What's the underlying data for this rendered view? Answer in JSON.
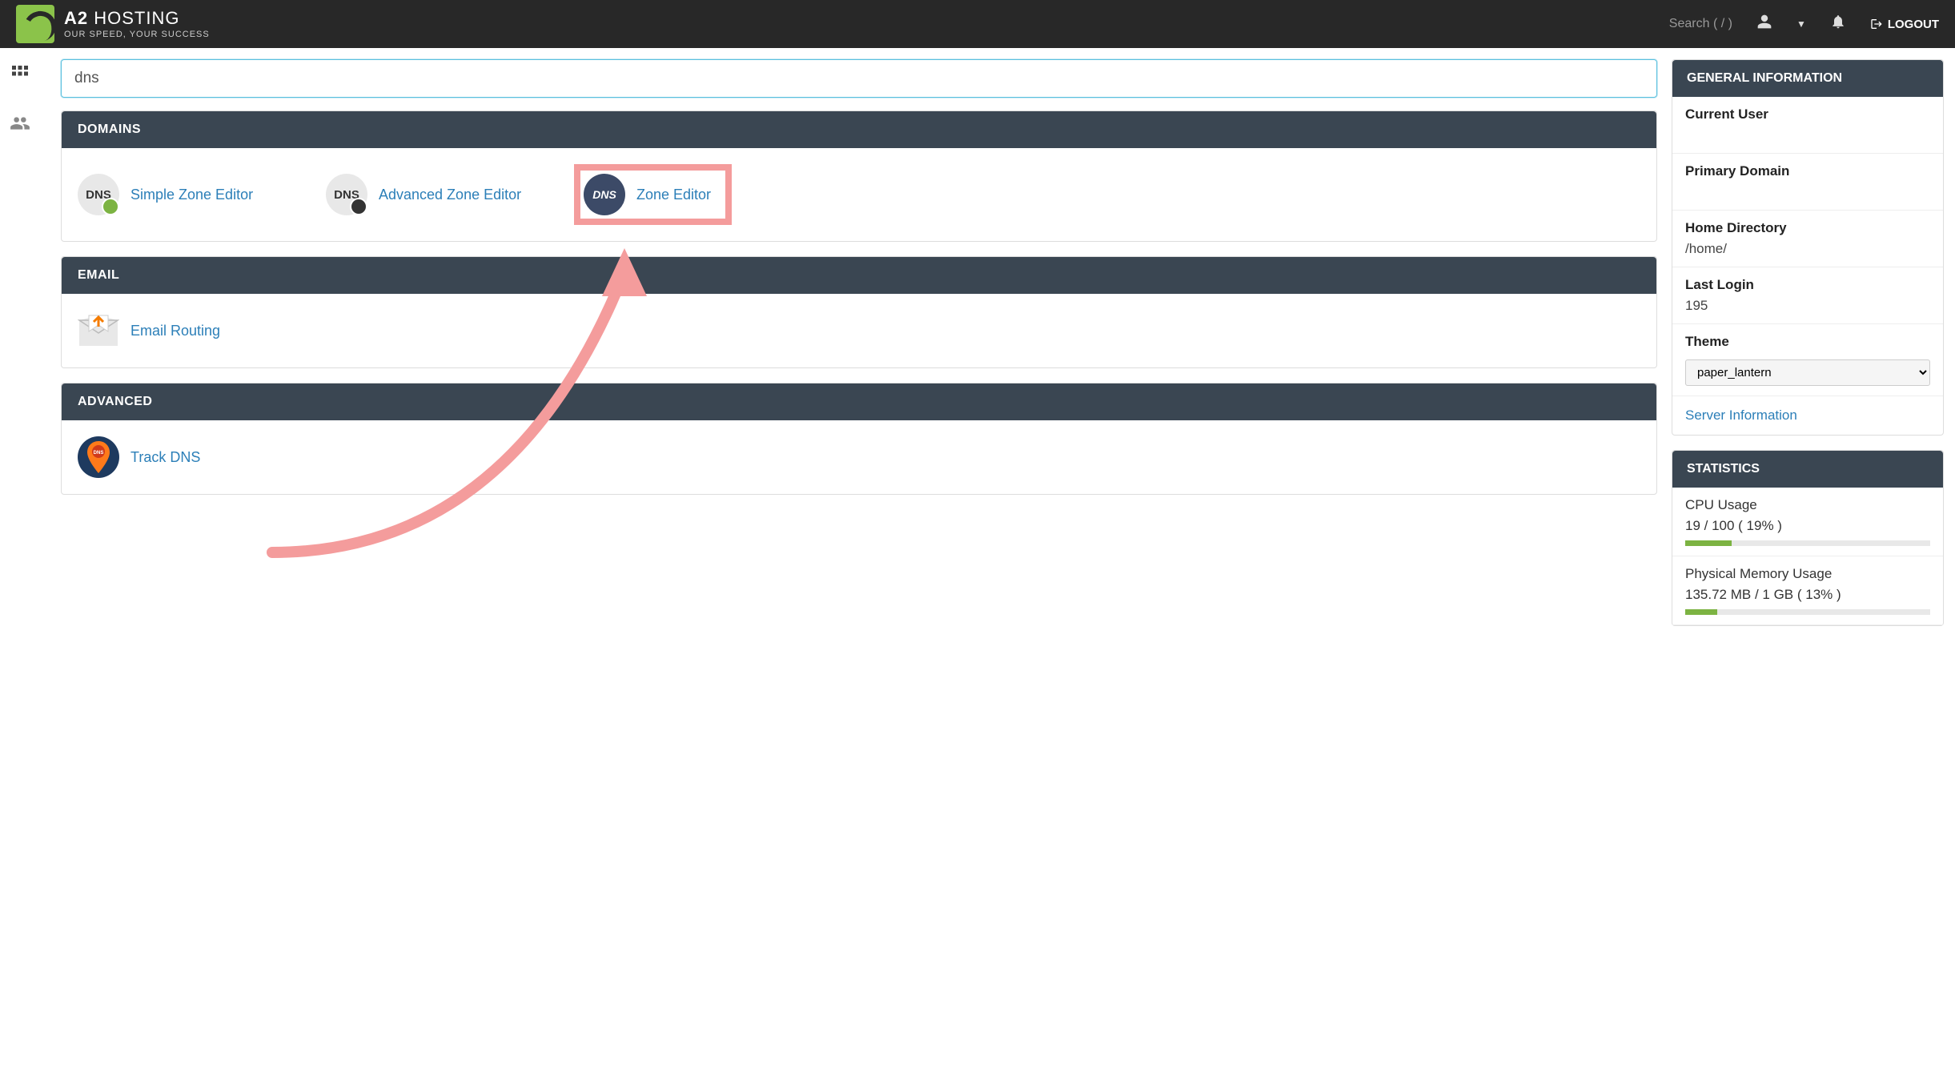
{
  "navbar": {
    "brand_main": "A2",
    "brand_secondary": "HOSTING",
    "brand_tagline": "OUR SPEED, YOUR SUCCESS",
    "search_placeholder": "Search ( / )",
    "logout_label": "LOGOUT"
  },
  "search": {
    "value": "dns"
  },
  "categories": {
    "domains": {
      "title": "DOMAINS",
      "items": {
        "simple": "Simple Zone Editor",
        "simple_icon_text": "DNS",
        "advanced": "Advanced Zone Editor",
        "advanced_icon_text": "DNS",
        "zone": "Zone Editor",
        "zone_icon_text": "DNS"
      }
    },
    "email": {
      "title": "EMAIL",
      "items": {
        "routing": "Email Routing"
      }
    },
    "advanced": {
      "title": "ADVANCED",
      "items": {
        "track": "Track DNS"
      }
    }
  },
  "general_info": {
    "title": "GENERAL INFORMATION",
    "current_user_label": "Current User",
    "current_user_value": "",
    "primary_domain_label": "Primary Domain",
    "primary_domain_value": "",
    "home_dir_label": "Home Directory",
    "home_dir_value": "/home/",
    "last_login_label": "Last Login",
    "last_login_value": "195",
    "theme_label": "Theme",
    "theme_value": "paper_lantern",
    "server_info_label": "Server Information"
  },
  "statistics": {
    "title": "STATISTICS",
    "cpu_label": "CPU Usage",
    "cpu_value": "19 / 100 ( 19% )",
    "cpu_percent": 19,
    "mem_label": "Physical Memory Usage",
    "mem_value": "135.72 MB / 1 GB ( 13% )",
    "mem_percent": 13
  }
}
